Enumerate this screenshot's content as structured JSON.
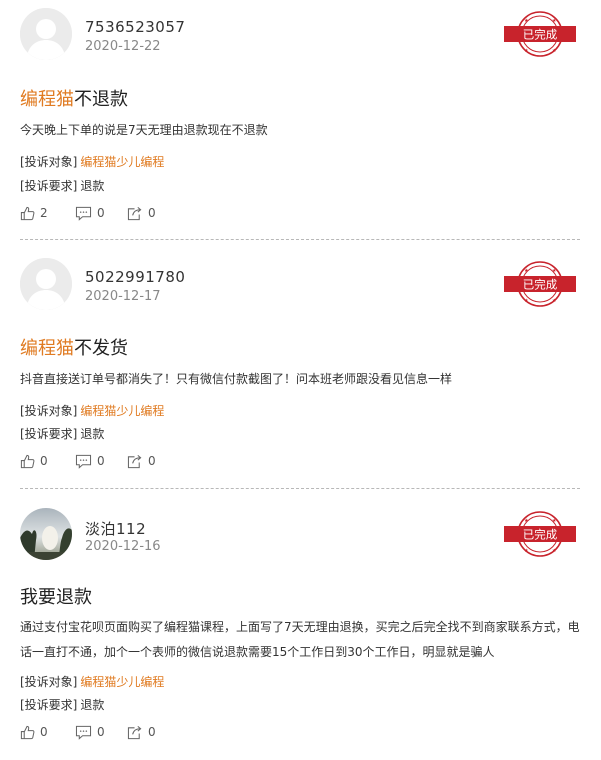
{
  "labels": {
    "target_label": "[投诉对象]",
    "demand_label": "[投诉要求]"
  },
  "colors": {
    "brand_orange": "#e07b22",
    "stamp_red": "#c8232c"
  },
  "complaints": [
    {
      "username": "7536523057",
      "date": "2020-12-22",
      "stamp_text": "已完成",
      "title_brand": "编程猫",
      "title_rest": "不退款",
      "body": "今天晚上下单的说是7天无理由退款现在不退款",
      "target": "编程猫少儿编程",
      "demand": "退款",
      "likes": "2",
      "comments": "0",
      "shares": "0",
      "avatar": "default-avatar"
    },
    {
      "username": "5022991780",
      "date": "2020-12-17",
      "stamp_text": "已完成",
      "title_brand": "编程猫",
      "title_rest": "不发货",
      "body": "抖音直接送订单号都消失了！只有微信付款截图了！问本班老师跟没看见信息一样",
      "target": "编程猫少儿编程",
      "demand": "退款",
      "likes": "0",
      "comments": "0",
      "shares": "0",
      "avatar": "default-avatar"
    },
    {
      "username": "淡泊112",
      "date": "2020-12-16",
      "stamp_text": "已完成",
      "title_brand": "",
      "title_rest": "我要退款",
      "body": "通过支付宝花呗页面购买了编程猫课程，上面写了7天无理由退换，买完之后完全找不到商家联系方式，电话一直打不通，加个一个表师的微信说退款需要15个工作日到30个工作日，明显就是骗人",
      "target": "编程猫少儿编程",
      "demand": "退款",
      "likes": "0",
      "comments": "0",
      "shares": "0",
      "avatar": "photo-avatar"
    }
  ]
}
